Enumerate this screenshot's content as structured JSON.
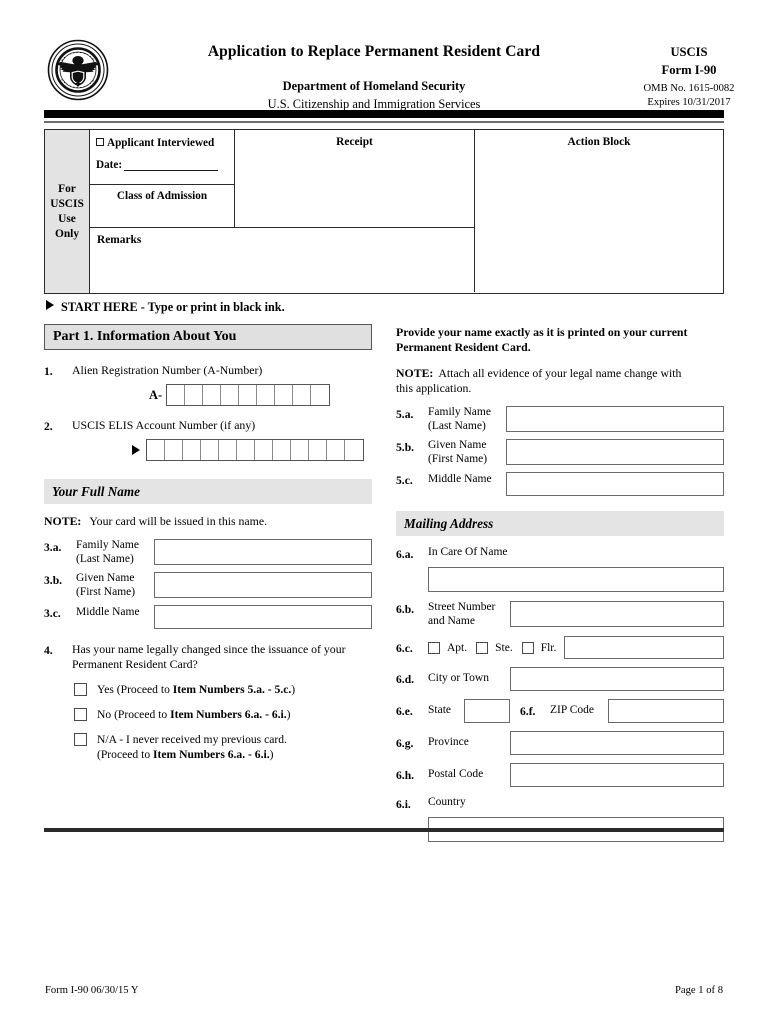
{
  "header": {
    "title": "Application to Replace Permanent Resident Card",
    "department": "Department of Homeland Security",
    "agency": "U.S. Citizenship and Immigration Services",
    "uscis": "USCIS",
    "form_no": "Form I-90",
    "omb": "OMB No. 1615-0082",
    "expires": "Expires 10/31/2017",
    "seal_alt": "Department of Homeland Security Seal"
  },
  "uscis_block": {
    "side_label": "For\nUSCIS\nUse\nOnly",
    "side_label_lines": [
      "For",
      "USCIS",
      "Use",
      "Only"
    ],
    "applicant_interviewed": "Applicant Interviewed",
    "date_label": "Date:",
    "class_of_admission": "Class of Admission",
    "receipt": "Receipt",
    "remarks": "Remarks",
    "action_block": "Action Block"
  },
  "start_here": "START HERE - Type or print in black ink.",
  "part1": {
    "heading": "Part 1.  Information About You",
    "item1": {
      "num": "1.",
      "label": "Alien Registration Number (A-Number)",
      "prefix": "A-",
      "cells": 9
    },
    "item2": {
      "num": "2.",
      "label": "USCIS ELIS Account Number (if any)",
      "cells": 12
    },
    "full_name_heading": "Your Full Name",
    "full_name_note_label": "NOTE:",
    "full_name_note": "Your card will be issued in this name.",
    "item3a": {
      "num": "3.a.",
      "label_line1": "Family Name",
      "label_line2": "(Last Name)",
      "value": ""
    },
    "item3b": {
      "num": "3.b.",
      "label_line1": "Given Name",
      "label_line2": "(First Name)",
      "value": ""
    },
    "item3c": {
      "num": "3.c.",
      "label_line1": "Middle Name",
      "label_line2": "",
      "value": ""
    },
    "item4": {
      "num": "4.",
      "question_line1": "Has your name legally changed since the issuance of your",
      "question_line2": "Permanent Resident Card?",
      "options": [
        {
          "prefix": "Yes (Proceed to ",
          "bold": "Item Numbers 5.a. - 5.c.",
          "suffix": ")",
          "line2": ""
        },
        {
          "prefix": "No (Proceed to ",
          "bold": "Item Numbers 6.a. - 6.i.",
          "suffix": ")",
          "line2": ""
        },
        {
          "prefix": "N/A - I never received my previous card.",
          "bold": "",
          "suffix": "",
          "line2_prefix": "(Proceed to ",
          "line2_bold": "Item Numbers 6.a. - 6.i.",
          "line2_suffix": ")"
        }
      ]
    }
  },
  "right": {
    "instruction_line1": "Provide your name exactly as it is printed on your current",
    "instruction_line2": "Permanent Resident Card.",
    "note_label": "NOTE:",
    "note_line1": "Attach all evidence of your legal name change with",
    "note_line2": "this application.",
    "item5a": {
      "num": "5.a.",
      "label_line1": "Family Name",
      "label_line2": "(Last Name)",
      "value": ""
    },
    "item5b": {
      "num": "5.b.",
      "label_line1": "Given Name",
      "label_line2": "(First Name)",
      "value": ""
    },
    "item5c": {
      "num": "5.c.",
      "label_line1": "Middle Name",
      "label_line2": "",
      "value": ""
    },
    "mailing_heading": "Mailing Address",
    "item6a": {
      "num": "6.a.",
      "label": "In Care Of Name",
      "value": ""
    },
    "item6b": {
      "num": "6.b.",
      "label_line1": "Street Number",
      "label_line2": "and Name",
      "value": ""
    },
    "item6c": {
      "num": "6.c.",
      "opt1": "Apt.",
      "opt2": "Ste.",
      "opt3": "Flr.",
      "value": ""
    },
    "item6d": {
      "num": "6.d.",
      "label": "City or Town",
      "value": ""
    },
    "item6e": {
      "num": "6.e.",
      "label": "State",
      "value": ""
    },
    "item6f": {
      "num": "6.f.",
      "label": "ZIP Code",
      "value": ""
    },
    "item6g": {
      "num": "6.g.",
      "label": "Province",
      "value": ""
    },
    "item6h": {
      "num": "6.h.",
      "label": "Postal Code",
      "value": ""
    },
    "item6i": {
      "num": "6.i.",
      "label": "Country",
      "value": ""
    }
  },
  "footer": {
    "left": "Form I-90   06/30/15   Y",
    "right": "Page 1 of 8"
  },
  "colors": {
    "rule": "#000000",
    "bar_gray": "#e0e0e0",
    "section_gray": "#e4e4e4",
    "box_border": "#6a6a6a",
    "table_border": "#2b2b2b"
  }
}
